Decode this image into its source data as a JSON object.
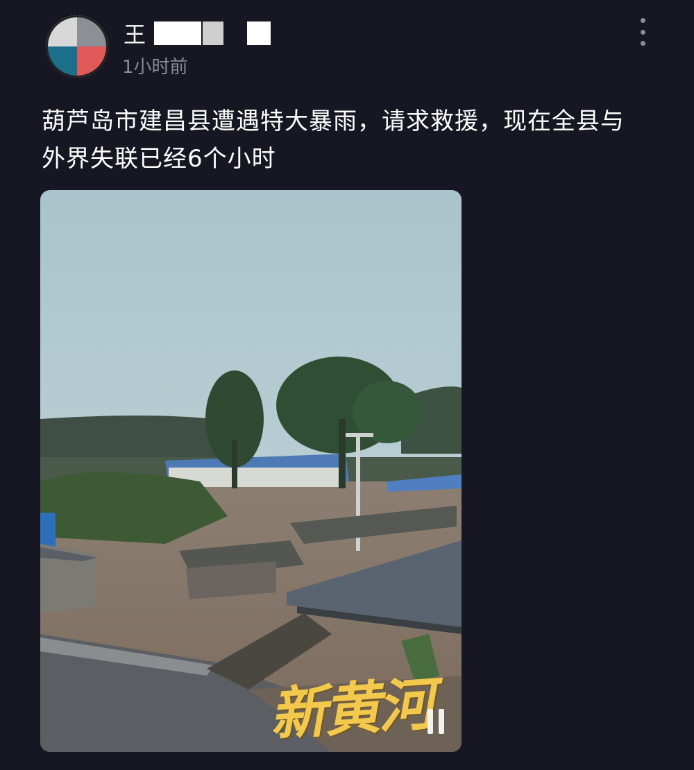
{
  "post": {
    "author_name": "王",
    "time": "1小时前",
    "text_line1": "葫芦岛市建昌县遭遇特大暴雨，请求救援，现在全县与",
    "text_line2": "外界失联已经6个小时",
    "media": {
      "watermark": "新黄河",
      "icon": "pause-icon"
    }
  },
  "icons": {
    "menu": "more-vertical-icon",
    "avatar": "avatar"
  },
  "colors": {
    "background": "#161722",
    "text": "#ffffff",
    "secondary_text": "#8a8c96",
    "watermark": "#f2c94c"
  }
}
